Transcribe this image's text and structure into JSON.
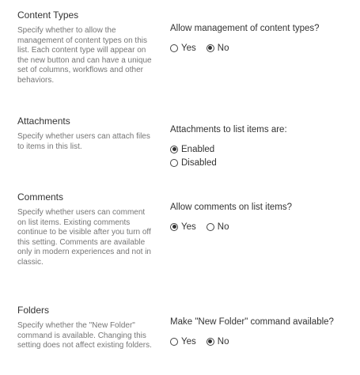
{
  "sections": [
    {
      "title": "Content Types",
      "description": "Specify whether to allow the management of content types on this list. Each content type will appear on the new button and can have a unique set of columns, workflows and other behaviors.",
      "question": "Allow management of content types?",
      "options": [
        {
          "label": "Yes",
          "selected": false
        },
        {
          "label": "No",
          "selected": true
        }
      ]
    },
    {
      "title": "Attachments",
      "description": "Specify whether users can attach files to items in this list.",
      "question": "Attachments to list items are:",
      "options": [
        {
          "label": "Enabled",
          "selected": true
        },
        {
          "label": "Disabled",
          "selected": false
        }
      ]
    },
    {
      "title": "Comments",
      "description": "Specify whether users can comment on list items. Existing comments continue to be visible after you turn off this setting. Comments are available only in modern experiences and not in classic.",
      "question": "Allow comments on list items?",
      "options": [
        {
          "label": "Yes",
          "selected": true
        },
        {
          "label": "No",
          "selected": false
        }
      ]
    },
    {
      "title": "Folders",
      "description": "Specify whether the \"New Folder\" command is available. Changing this setting does not affect existing folders.",
      "question": "Make \"New Folder\" command available?",
      "options": [
        {
          "label": "Yes",
          "selected": false
        },
        {
          "label": "No",
          "selected": true
        }
      ]
    }
  ]
}
